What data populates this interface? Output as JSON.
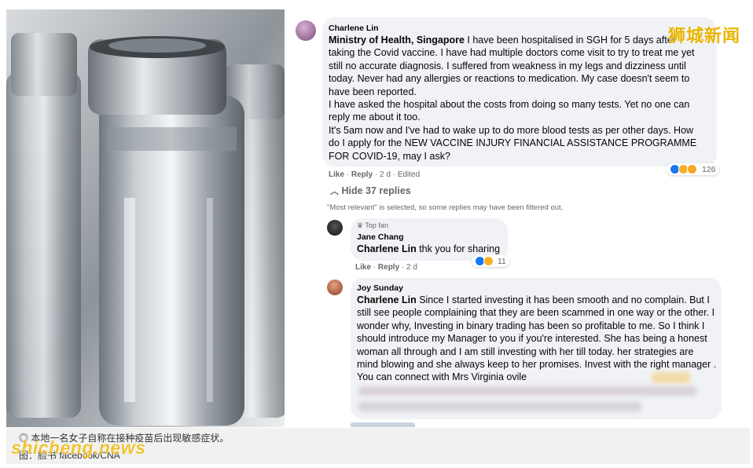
{
  "watermark_top": "狮城新闻",
  "photo": {
    "alt": "vaccine vials"
  },
  "main_comment": {
    "author": "Charlene Lin",
    "mention": "Ministry of Health, Singapore",
    "line1_rest": " I have been hospitalised in SGH for 5 days after taking the Covid vaccine. I have had multiple doctors come visit to try to treat me yet still no accurate diagnosis. I suffered from weakness in my legs and dizziness until today. Never had any allergies or reactions to medication. My case doesn't seem to have been reported.",
    "para2": "I have asked the hospital about the costs from doing so many tests. Yet no one can reply me about it too.",
    "para3": "It's 5am now and I've had to wake up to do more blood tests as per other days. How do I apply for the NEW VACCINE INJURY FINANCIAL ASSISTANCE PROGRAMME FOR COVID-19, may I ask?",
    "like": "Like",
    "reply": "Reply",
    "meta_rest": "· 2 d · Edited",
    "reaction_count": "126"
  },
  "hide_replies": "Hide 37 replies",
  "filter_note": "\"Most relevant\" is selected, so some replies may have been filtered out.",
  "reply1": {
    "badge": "Top fan",
    "author": "Jane Chang",
    "mention": "Charlene Lin",
    "text": " thk you for sharing",
    "like": "Like",
    "reply": "Reply",
    "meta_rest": "· 2 d",
    "reaction_count": "11"
  },
  "reply2": {
    "author": "Joy Sunday",
    "mention": "Charlene Lin",
    "text": " Since I started investing it has been smooth and no complain. But I still see people complaining that they are been scammed in one way or the other. I wonder why, Investing in binary trading has been so profitable to me. So I think I should introduce my Manager to you if you're interested. She has being a honest woman all through and I am still investing with her till today. her strategies are mind blowing and she always keep to her promises. Invest with the right manager . You can connect with Mrs Virginia ovile"
  },
  "caption": {
    "line1": "本地一名女子自称在接种疫苗后出现敏感症状。",
    "line2": "图：脸书 facebook/CNA",
    "watermark": "shicheng.news"
  },
  "colors": {
    "accent": "#1877f2",
    "bubble": "#f0f2f5",
    "watermark": "#e9b400"
  }
}
